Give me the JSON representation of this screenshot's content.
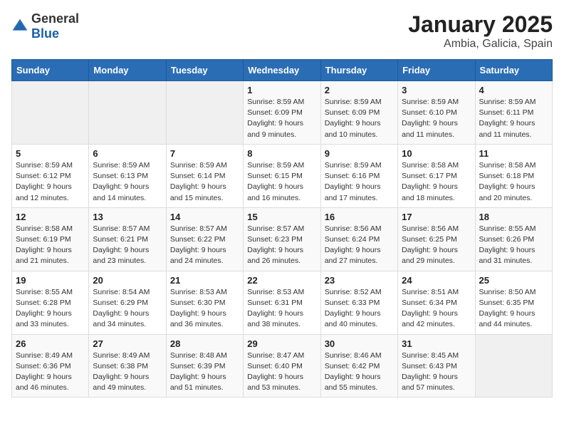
{
  "logo": {
    "general": "General",
    "blue": "Blue"
  },
  "title": "January 2025",
  "subtitle": "Ambia, Galicia, Spain",
  "weekdays": [
    "Sunday",
    "Monday",
    "Tuesday",
    "Wednesday",
    "Thursday",
    "Friday",
    "Saturday"
  ],
  "weeks": [
    [
      {
        "day": "",
        "sunrise": "",
        "sunset": "",
        "daylight": ""
      },
      {
        "day": "",
        "sunrise": "",
        "sunset": "",
        "daylight": ""
      },
      {
        "day": "",
        "sunrise": "",
        "sunset": "",
        "daylight": ""
      },
      {
        "day": "1",
        "sunrise": "Sunrise: 8:59 AM",
        "sunset": "Sunset: 6:09 PM",
        "daylight": "Daylight: 9 hours and 9 minutes."
      },
      {
        "day": "2",
        "sunrise": "Sunrise: 8:59 AM",
        "sunset": "Sunset: 6:09 PM",
        "daylight": "Daylight: 9 hours and 10 minutes."
      },
      {
        "day": "3",
        "sunrise": "Sunrise: 8:59 AM",
        "sunset": "Sunset: 6:10 PM",
        "daylight": "Daylight: 9 hours and 11 minutes."
      },
      {
        "day": "4",
        "sunrise": "Sunrise: 8:59 AM",
        "sunset": "Sunset: 6:11 PM",
        "daylight": "Daylight: 9 hours and 11 minutes."
      }
    ],
    [
      {
        "day": "5",
        "sunrise": "Sunrise: 8:59 AM",
        "sunset": "Sunset: 6:12 PM",
        "daylight": "Daylight: 9 hours and 12 minutes."
      },
      {
        "day": "6",
        "sunrise": "Sunrise: 8:59 AM",
        "sunset": "Sunset: 6:13 PM",
        "daylight": "Daylight: 9 hours and 14 minutes."
      },
      {
        "day": "7",
        "sunrise": "Sunrise: 8:59 AM",
        "sunset": "Sunset: 6:14 PM",
        "daylight": "Daylight: 9 hours and 15 minutes."
      },
      {
        "day": "8",
        "sunrise": "Sunrise: 8:59 AM",
        "sunset": "Sunset: 6:15 PM",
        "daylight": "Daylight: 9 hours and 16 minutes."
      },
      {
        "day": "9",
        "sunrise": "Sunrise: 8:59 AM",
        "sunset": "Sunset: 6:16 PM",
        "daylight": "Daylight: 9 hours and 17 minutes."
      },
      {
        "day": "10",
        "sunrise": "Sunrise: 8:58 AM",
        "sunset": "Sunset: 6:17 PM",
        "daylight": "Daylight: 9 hours and 18 minutes."
      },
      {
        "day": "11",
        "sunrise": "Sunrise: 8:58 AM",
        "sunset": "Sunset: 6:18 PM",
        "daylight": "Daylight: 9 hours and 20 minutes."
      }
    ],
    [
      {
        "day": "12",
        "sunrise": "Sunrise: 8:58 AM",
        "sunset": "Sunset: 6:19 PM",
        "daylight": "Daylight: 9 hours and 21 minutes."
      },
      {
        "day": "13",
        "sunrise": "Sunrise: 8:57 AM",
        "sunset": "Sunset: 6:21 PM",
        "daylight": "Daylight: 9 hours and 23 minutes."
      },
      {
        "day": "14",
        "sunrise": "Sunrise: 8:57 AM",
        "sunset": "Sunset: 6:22 PM",
        "daylight": "Daylight: 9 hours and 24 minutes."
      },
      {
        "day": "15",
        "sunrise": "Sunrise: 8:57 AM",
        "sunset": "Sunset: 6:23 PM",
        "daylight": "Daylight: 9 hours and 26 minutes."
      },
      {
        "day": "16",
        "sunrise": "Sunrise: 8:56 AM",
        "sunset": "Sunset: 6:24 PM",
        "daylight": "Daylight: 9 hours and 27 minutes."
      },
      {
        "day": "17",
        "sunrise": "Sunrise: 8:56 AM",
        "sunset": "Sunset: 6:25 PM",
        "daylight": "Daylight: 9 hours and 29 minutes."
      },
      {
        "day": "18",
        "sunrise": "Sunrise: 8:55 AM",
        "sunset": "Sunset: 6:26 PM",
        "daylight": "Daylight: 9 hours and 31 minutes."
      }
    ],
    [
      {
        "day": "19",
        "sunrise": "Sunrise: 8:55 AM",
        "sunset": "Sunset: 6:28 PM",
        "daylight": "Daylight: 9 hours and 33 minutes."
      },
      {
        "day": "20",
        "sunrise": "Sunrise: 8:54 AM",
        "sunset": "Sunset: 6:29 PM",
        "daylight": "Daylight: 9 hours and 34 minutes."
      },
      {
        "day": "21",
        "sunrise": "Sunrise: 8:53 AM",
        "sunset": "Sunset: 6:30 PM",
        "daylight": "Daylight: 9 hours and 36 minutes."
      },
      {
        "day": "22",
        "sunrise": "Sunrise: 8:53 AM",
        "sunset": "Sunset: 6:31 PM",
        "daylight": "Daylight: 9 hours and 38 minutes."
      },
      {
        "day": "23",
        "sunrise": "Sunrise: 8:52 AM",
        "sunset": "Sunset: 6:33 PM",
        "daylight": "Daylight: 9 hours and 40 minutes."
      },
      {
        "day": "24",
        "sunrise": "Sunrise: 8:51 AM",
        "sunset": "Sunset: 6:34 PM",
        "daylight": "Daylight: 9 hours and 42 minutes."
      },
      {
        "day": "25",
        "sunrise": "Sunrise: 8:50 AM",
        "sunset": "Sunset: 6:35 PM",
        "daylight": "Daylight: 9 hours and 44 minutes."
      }
    ],
    [
      {
        "day": "26",
        "sunrise": "Sunrise: 8:49 AM",
        "sunset": "Sunset: 6:36 PM",
        "daylight": "Daylight: 9 hours and 46 minutes."
      },
      {
        "day": "27",
        "sunrise": "Sunrise: 8:49 AM",
        "sunset": "Sunset: 6:38 PM",
        "daylight": "Daylight: 9 hours and 49 minutes."
      },
      {
        "day": "28",
        "sunrise": "Sunrise: 8:48 AM",
        "sunset": "Sunset: 6:39 PM",
        "daylight": "Daylight: 9 hours and 51 minutes."
      },
      {
        "day": "29",
        "sunrise": "Sunrise: 8:47 AM",
        "sunset": "Sunset: 6:40 PM",
        "daylight": "Daylight: 9 hours and 53 minutes."
      },
      {
        "day": "30",
        "sunrise": "Sunrise: 8:46 AM",
        "sunset": "Sunset: 6:42 PM",
        "daylight": "Daylight: 9 hours and 55 minutes."
      },
      {
        "day": "31",
        "sunrise": "Sunrise: 8:45 AM",
        "sunset": "Sunset: 6:43 PM",
        "daylight": "Daylight: 9 hours and 57 minutes."
      },
      {
        "day": "",
        "sunrise": "",
        "sunset": "",
        "daylight": ""
      }
    ]
  ]
}
